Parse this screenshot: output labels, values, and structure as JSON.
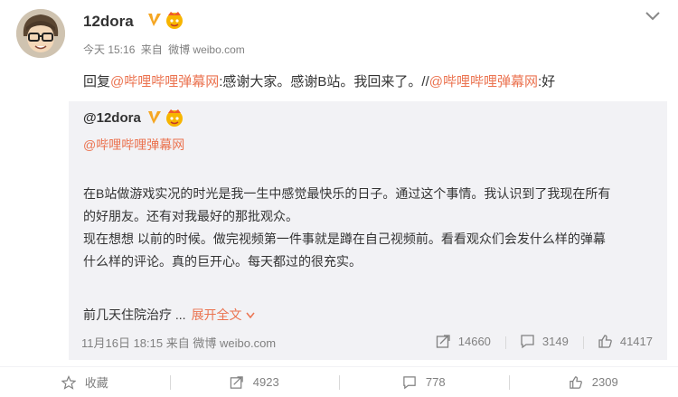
{
  "post": {
    "username": "12dora",
    "time": "今天 15:16",
    "from_label": "来自",
    "source": "微博 weibo.com",
    "reply": {
      "prefix": "回复",
      "mention": "@哔哩哔哩弹幕网",
      "text": ":感谢大家。感谢B站。我回来了。//",
      "mention2": "@哔哩哔哩弹幕网",
      "suffix": ":好"
    }
  },
  "repost": {
    "username": "@12dora",
    "mention": "@哔哩哔哩弹幕网",
    "body": [
      "在B站做游戏实况的时光是我一生中感觉最快乐的日子。通过这个事情。我认识到了我现在所有",
      "的好朋友。还有对我最好的那批观众。",
      "现在想想 以前的时候。做完视频第一件事就是蹲在自己视频前。看看观众们会发什么样的弹幕",
      "什么样的评论。真的巨开心。每天都过的很充实。"
    ],
    "more_text": "前几天住院治疗 ...",
    "expand_label": "展开全文",
    "time": "11月16日 18:15",
    "from_label": "来自",
    "source": "微博 weibo.com",
    "reposts": "14660",
    "comments": "3149",
    "likes": "41417"
  },
  "actions": {
    "favorite": "收藏",
    "repost": "4923",
    "comment": "778",
    "like": "2309"
  },
  "colors": {
    "accent": "#eb7350",
    "verified": "#f5a623",
    "card_bg": "#f2f2f5",
    "muted": "#808080"
  },
  "icons": [
    "avatar",
    "verified-icon",
    "member-icon",
    "chevron-down-icon",
    "repost-icon",
    "comment-icon",
    "like-icon",
    "star-icon"
  ]
}
